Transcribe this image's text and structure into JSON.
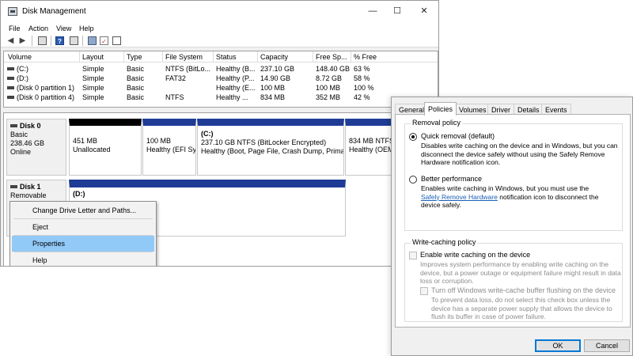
{
  "window": {
    "title": "Disk Management",
    "minimize": "—",
    "maximize": "☐",
    "close": "✕"
  },
  "menu": [
    "File",
    "Action",
    "View",
    "Help"
  ],
  "toolbar": {
    "icons": [
      "back-arrow-icon",
      "forward-arrow-icon",
      "console-tree-icon",
      "help-icon",
      "properties-icon",
      "connect-icon",
      "checklist-icon",
      "disk-view-icon"
    ],
    "back": "◀",
    "forward": "▶",
    "help": "?"
  },
  "volume_list": {
    "columns": [
      "Volume",
      "Layout",
      "Type",
      "File System",
      "Status",
      "Capacity",
      "Free Sp...",
      "% Free"
    ],
    "rows": [
      [
        "(C:)",
        "Simple",
        "Basic",
        "NTFS (BitLo...",
        "Healthy (B...",
        "237.10 GB",
        "148.40 GB",
        "63 %"
      ],
      [
        "(D:)",
        "Simple",
        "Basic",
        "FAT32",
        "Healthy (P...",
        "14.90 GB",
        "8.72 GB",
        "58 %"
      ],
      [
        "(Disk 0 partition 1)",
        "Simple",
        "Basic",
        "",
        "Healthy (E...",
        "100 MB",
        "100 MB",
        "100 %"
      ],
      [
        "(Disk 0 partition 4)",
        "Simple",
        "Basic",
        "NTFS",
        "Healthy ...",
        "834 MB",
        "352 MB",
        "42 %"
      ]
    ]
  },
  "disk0": {
    "name": "Disk 0",
    "type": "Basic",
    "size": "238.46 GB",
    "status": "Online",
    "partitions": [
      {
        "title": "",
        "line1": "451 MB",
        "line2": "Unallocated"
      },
      {
        "title": "",
        "line1": "100 MB",
        "line2": "Healthy (EFI Sy"
      },
      {
        "title": "(C:)",
        "line1": "237.10 GB NTFS (BitLocker Encrypted)",
        "line2": "Healthy (Boot, Page File, Crash Dump, Primar"
      },
      {
        "title": "",
        "line1": "834 MB NTFS",
        "line2": "Healthy (OEM"
      }
    ]
  },
  "disk1": {
    "name": "Disk 1",
    "type": "Removable",
    "partition_title": "(D:)"
  },
  "context_menu": {
    "items": [
      "Change Drive Letter and Paths...",
      "Eject",
      "Properties",
      "Help"
    ],
    "highlighted": "Properties"
  },
  "properties": {
    "tabs": [
      "General",
      "Policies",
      "Volumes",
      "Driver",
      "Details",
      "Events"
    ],
    "active_tab": "Policies",
    "removal_policy": {
      "title": "Removal policy",
      "quick_label": "Quick removal (default)",
      "quick_selected": true,
      "quick_desc_1": "Disables write caching on the device and in Windows, but you can",
      "quick_desc_2": "disconnect the device safely without using the Safely Remove",
      "quick_desc_3": "Hardware notification icon.",
      "better_label": "Better performance",
      "better_selected": false,
      "better_desc_1": "Enables write caching in Windows, but you must use the",
      "better_link": "Safely Remove Hardware",
      "better_desc_2": "notification icon to disconnect the",
      "better_desc_3": "device safely."
    },
    "write_caching": {
      "title": "Write-caching policy",
      "enable_label": "Enable write caching on the device",
      "enable_desc_1": "Improves system performance by enabling write caching on the",
      "enable_desc_2": "device, but a power outage or equipment failure might result in data",
      "enable_desc_3": "loss or corruption.",
      "flush_label": "Turn off Windows write-cache buffer flushing on the device",
      "flush_desc_1": "To prevent data loss, do not select this check box unless the",
      "flush_desc_2": "device has a separate power supply that allows the device to",
      "flush_desc_3": "flush its buffer in case of power failure."
    },
    "ok": "OK",
    "cancel": "Cancel",
    "colors": {
      "accent": "#0078d7",
      "link": "#1a5fb4",
      "partition_bar": "#1e3c96",
      "highlight": "#91c9f7"
    }
  }
}
